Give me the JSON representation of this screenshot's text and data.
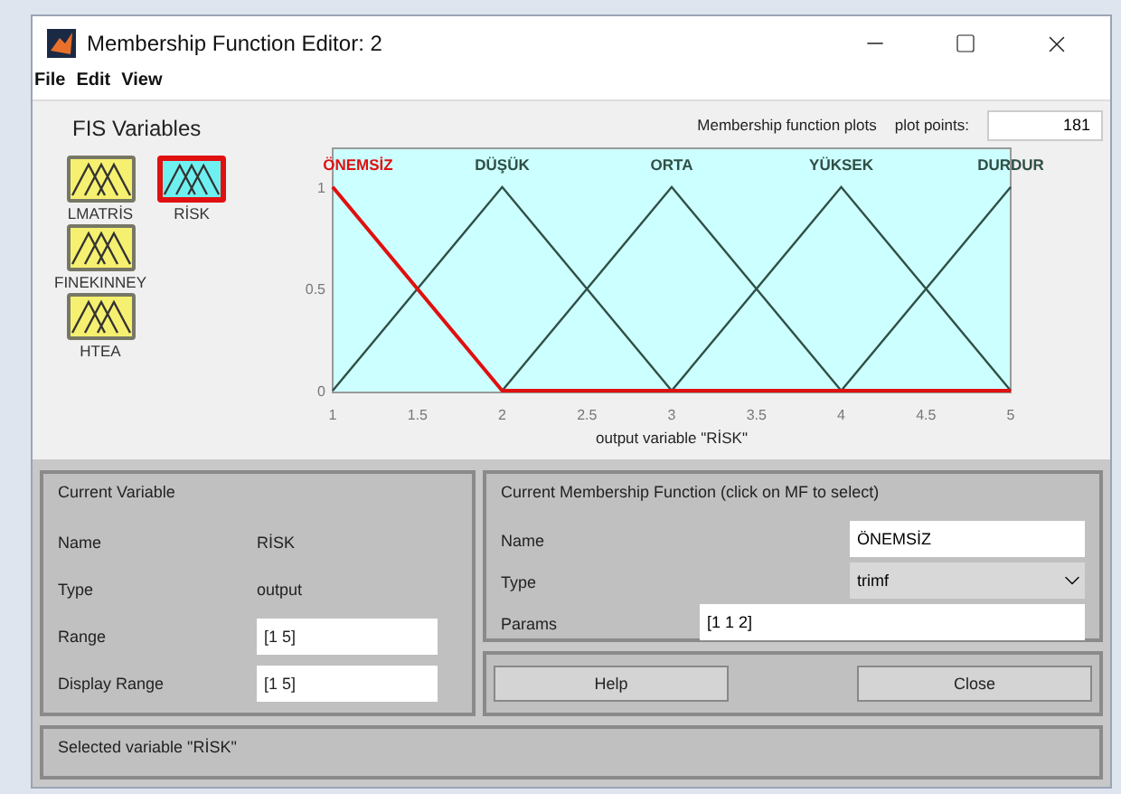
{
  "window": {
    "title": "Membership Function Editor: 2"
  },
  "menu": [
    "File",
    "Edit",
    "View"
  ],
  "fis_variables": {
    "title": "FIS Variables",
    "items": [
      {
        "name": "LMATRİS",
        "kind": "input",
        "selected": false
      },
      {
        "name": "FINEKINNEY",
        "kind": "input",
        "selected": false
      },
      {
        "name": "HTEA",
        "kind": "input",
        "selected": false
      },
      {
        "name": "RİSK",
        "kind": "output",
        "selected": true
      }
    ]
  },
  "plot_header": {
    "title": "Membership function plots",
    "plot_points_label": "plot points:",
    "plot_points": "181"
  },
  "chart_data": {
    "type": "line",
    "xlabel": "output variable \"RİSK\"",
    "x": [
      1,
      2,
      3,
      4,
      5
    ],
    "xlim": [
      1,
      5
    ],
    "ylim": [
      0,
      1.19
    ],
    "xticks": [
      1,
      1.5,
      2,
      2.5,
      3,
      3.5,
      4,
      4.5,
      5
    ],
    "yticks": [
      0,
      0.5,
      1
    ],
    "series": [
      {
        "name": "ÖNEMSİZ",
        "color": "#e01010",
        "values": [
          1,
          0,
          0,
          0,
          0
        ]
      },
      {
        "name": "DÜŞÜK",
        "color": "#2f4f46",
        "values": [
          0,
          1,
          0,
          null,
          null
        ]
      },
      {
        "name": "ORTA",
        "color": "#2f4f46",
        "values": [
          null,
          0,
          1,
          0,
          null
        ]
      },
      {
        "name": "YÜKSEK",
        "color": "#2f4f46",
        "values": [
          null,
          null,
          0,
          1,
          0
        ]
      },
      {
        "name": "DURDUR",
        "color": "#2f4f46",
        "values": [
          null,
          null,
          null,
          0,
          1
        ]
      }
    ]
  },
  "current_variable": {
    "title": "Current Variable",
    "name_label": "Name",
    "name": "RİSK",
    "type_label": "Type",
    "type": "output",
    "range_label": "Range",
    "range": "[1 5]",
    "display_range_label": "Display Range",
    "display_range": "[1 5]"
  },
  "current_mf": {
    "title": "Current Membership Function (click on MF to select)",
    "name_label": "Name",
    "name": "ÖNEMSİZ",
    "type_label": "Type",
    "type": "trimf",
    "params_label": "Params",
    "params": "[1 1 2]"
  },
  "buttons": [
    "Help",
    "Close"
  ],
  "status": "Selected variable \"RİSK\""
}
